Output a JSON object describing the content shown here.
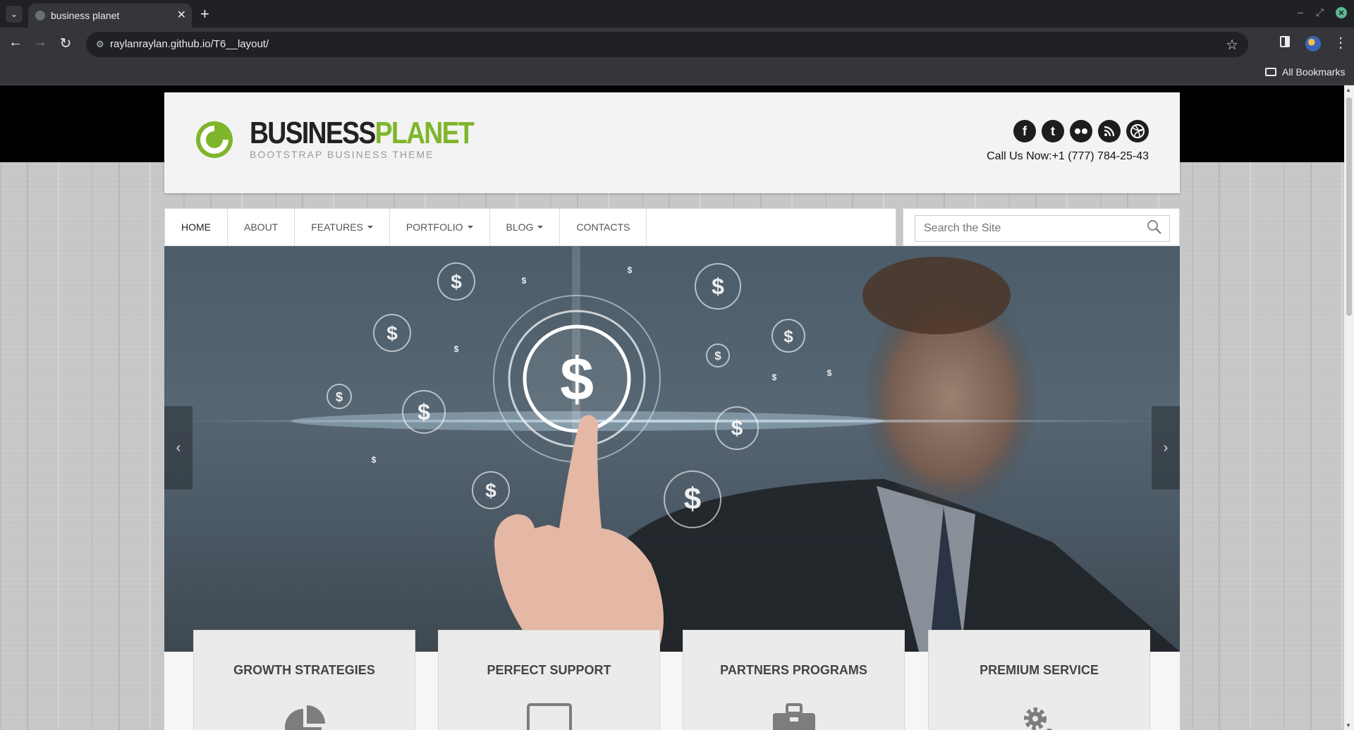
{
  "browser": {
    "tab_title": "business planet",
    "url": "raylanraylan.github.io/T6__layout/",
    "bookmarks_label": "All Bookmarks"
  },
  "site": {
    "logo_part1": "BUSINESS",
    "logo_part2": "PLANET",
    "tagline": "BOOTSTRAP BUSINESS THEME",
    "phone": "Call Us Now:+1 (777) 784-25-43",
    "social": [
      "facebook-icon",
      "twitter-icon",
      "flickr-icon",
      "rss-icon",
      "dribbble-icon"
    ],
    "nav": [
      {
        "label": "HOME",
        "dropdown": false
      },
      {
        "label": "ABOUT",
        "dropdown": false
      },
      {
        "label": "FEATURES",
        "dropdown": true
      },
      {
        "label": "PORTFOLIO",
        "dropdown": true
      },
      {
        "label": "BLOG",
        "dropdown": true
      },
      {
        "label": "CONTACTS",
        "dropdown": false
      }
    ],
    "search_placeholder": "Search the Site",
    "features": [
      {
        "title": "GROWTH STRATEGIES",
        "icon": "pie-chart-icon"
      },
      {
        "title": "PERFECT SUPPORT",
        "icon": "monitor-icon"
      },
      {
        "title": "PARTNERS PROGRAMS",
        "icon": "briefcase-icon"
      },
      {
        "title": "PREMIUM SERVICE",
        "icon": "gears-icon"
      }
    ],
    "colors": {
      "brand_green": "#7fb52b",
      "dark": "#222222"
    }
  }
}
